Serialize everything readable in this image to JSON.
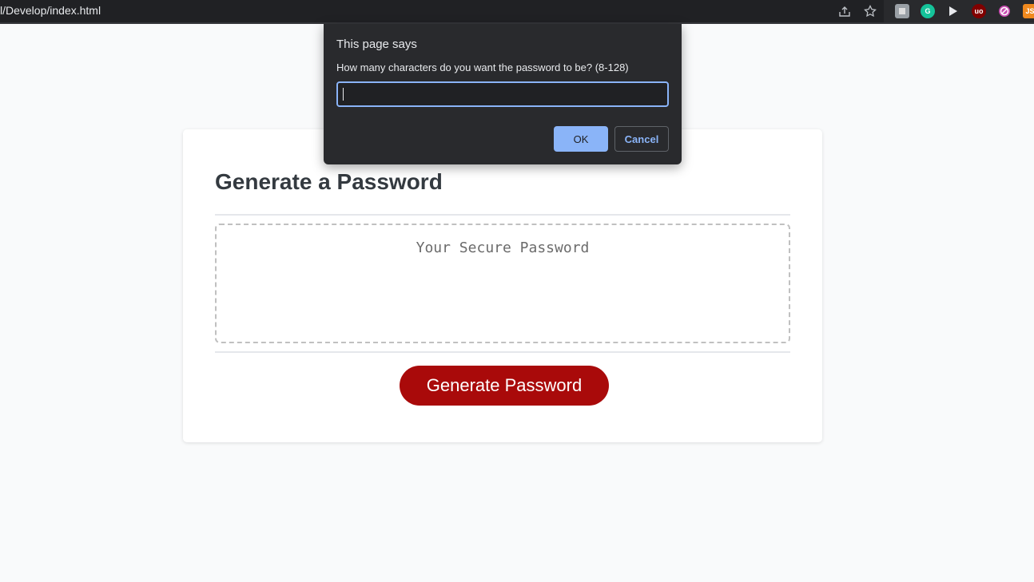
{
  "browser": {
    "url": "l/Develop/index.html",
    "icons": [
      "share-icon",
      "star-icon"
    ],
    "extensions": [
      {
        "name": "extension-puzzle-icon",
        "label": "",
        "color": "#9aa0a6"
      },
      {
        "name": "grammarly-icon",
        "label": "G",
        "color": "#15c39a"
      },
      {
        "name": "cursor-extension-icon",
        "label": "",
        "color": "#e8eaed"
      },
      {
        "name": "ublock-icon",
        "label": "uo",
        "color": "#800000"
      },
      {
        "name": "blocker-icon",
        "label": "",
        "color": "#c94eb2"
      },
      {
        "name": "js-extension-icon",
        "label": "JS",
        "color": "#f0891e"
      }
    ]
  },
  "dialog": {
    "title": "This page says",
    "message": "How many characters do you want the password to be? (8-128)",
    "input_value": "",
    "ok_label": "OK",
    "cancel_label": "Cancel"
  },
  "card": {
    "title": "Generate a Password",
    "password_placeholder": "Your Secure Password",
    "generate_label": "Generate Password",
    "accent_color": "#a90a0a"
  }
}
